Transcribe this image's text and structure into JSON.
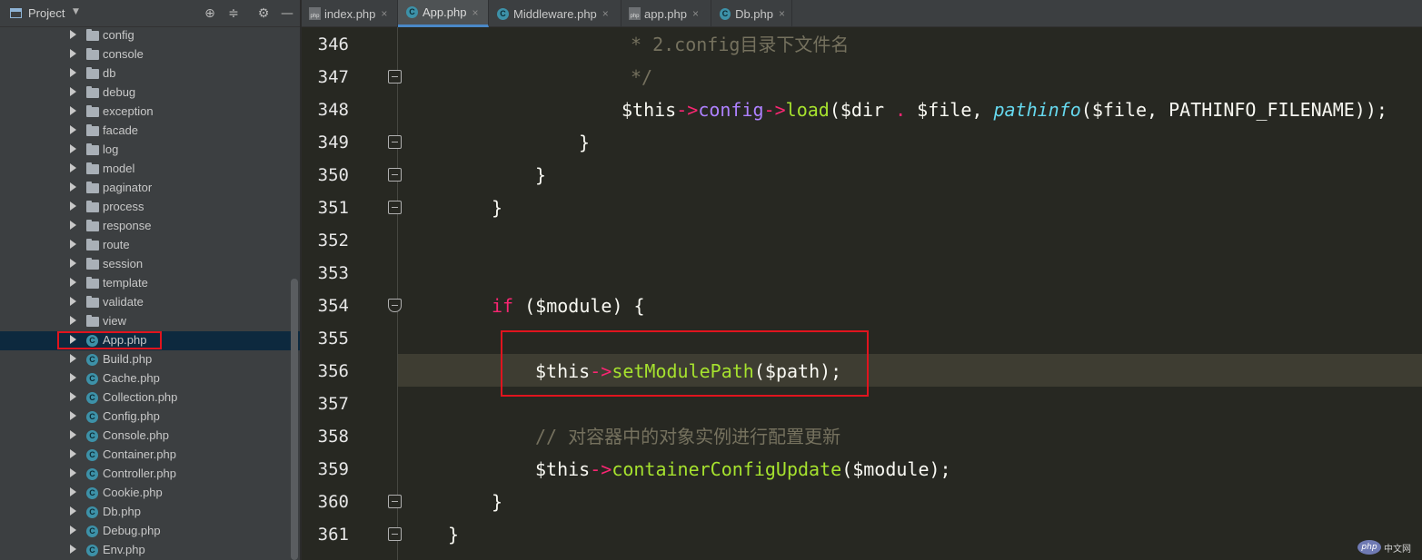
{
  "sidebar": {
    "title": "Project",
    "tree": [
      {
        "label": "config",
        "kind": "folder"
      },
      {
        "label": "console",
        "kind": "folder"
      },
      {
        "label": "db",
        "kind": "folder"
      },
      {
        "label": "debug",
        "kind": "folder"
      },
      {
        "label": "exception",
        "kind": "folder"
      },
      {
        "label": "facade",
        "kind": "folder"
      },
      {
        "label": "log",
        "kind": "folder"
      },
      {
        "label": "model",
        "kind": "folder"
      },
      {
        "label": "paginator",
        "kind": "folder"
      },
      {
        "label": "process",
        "kind": "folder"
      },
      {
        "label": "response",
        "kind": "folder"
      },
      {
        "label": "route",
        "kind": "folder"
      },
      {
        "label": "session",
        "kind": "folder"
      },
      {
        "label": "template",
        "kind": "folder"
      },
      {
        "label": "validate",
        "kind": "folder"
      },
      {
        "label": "view",
        "kind": "folder"
      },
      {
        "label": "App.php",
        "kind": "class",
        "selected": true
      },
      {
        "label": "Build.php",
        "kind": "class"
      },
      {
        "label": "Cache.php",
        "kind": "class"
      },
      {
        "label": "Collection.php",
        "kind": "class"
      },
      {
        "label": "Config.php",
        "kind": "class"
      },
      {
        "label": "Console.php",
        "kind": "class"
      },
      {
        "label": "Container.php",
        "kind": "class"
      },
      {
        "label": "Controller.php",
        "kind": "class"
      },
      {
        "label": "Cookie.php",
        "kind": "class"
      },
      {
        "label": "Db.php",
        "kind": "class"
      },
      {
        "label": "Debug.php",
        "kind": "class"
      },
      {
        "label": "Env.php",
        "kind": "class"
      }
    ]
  },
  "tabs": [
    {
      "label": "index.php",
      "icon": "php-file-icon",
      "active": false
    },
    {
      "label": "App.php",
      "icon": "class-icon",
      "active": true
    },
    {
      "label": "Middleware.php",
      "icon": "class-icon",
      "active": false
    },
    {
      "label": "app.php",
      "icon": "php-file-icon",
      "active": false
    },
    {
      "label": "Db.php",
      "icon": "class-icon",
      "active": false
    }
  ],
  "editor": {
    "lines": [
      {
        "number": "346",
        "fold": false,
        "indent": 362,
        "tokens": [
          [
            "c-comment",
            "* 2.config目录下文件名"
          ]
        ]
      },
      {
        "number": "347",
        "fold": true,
        "indent": 362,
        "tokens": [
          [
            "c-comment",
            "*/"
          ]
        ]
      },
      {
        "number": "348",
        "fold": false,
        "indent": 352,
        "tokens": [
          [
            "",
            "$this"
          ],
          [
            "c-op",
            "->"
          ],
          [
            "c-prop",
            "config"
          ],
          [
            "c-op",
            "->"
          ],
          [
            "c-method",
            "load"
          ],
          [
            "",
            "($dir "
          ],
          [
            "c-op",
            "."
          ],
          [
            "",
            " $file, "
          ],
          [
            "c-ital",
            "pathinfo"
          ],
          [
            "",
            "($file, PATHINFO_FILENAME));"
          ]
        ]
      },
      {
        "number": "349",
        "fold": true,
        "indent": 305,
        "tokens": [
          [
            "",
            "}"
          ]
        ]
      },
      {
        "number": "350",
        "fold": true,
        "indent": 257,
        "tokens": [
          [
            "",
            "}"
          ]
        ]
      },
      {
        "number": "351",
        "fold": true,
        "indent": 209,
        "tokens": [
          [
            "",
            "}"
          ]
        ]
      },
      {
        "number": "352",
        "fold": false,
        "indent": 209,
        "tokens": []
      },
      {
        "number": "353",
        "fold": false,
        "indent": 209,
        "tokens": []
      },
      {
        "number": "354",
        "fold": "open",
        "indent": 209,
        "tokens": [
          [
            "c-kw",
            "if"
          ],
          [
            "",
            " ($module) {"
          ]
        ]
      },
      {
        "number": "355",
        "fold": false,
        "indent": 257,
        "tokens": []
      },
      {
        "number": "356",
        "fold": false,
        "indent": 257,
        "tokens": [
          [
            "",
            "$this"
          ],
          [
            "c-op",
            "->"
          ],
          [
            "c-method",
            "setModulePath"
          ],
          [
            "",
            "($path);"
          ]
        ]
      },
      {
        "number": "357",
        "fold": false,
        "indent": 257,
        "tokens": []
      },
      {
        "number": "358",
        "fold": false,
        "indent": 257,
        "tokens": [
          [
            "c-comment",
            "// 对容器中的对象实例进行配置更新"
          ]
        ]
      },
      {
        "number": "359",
        "fold": false,
        "indent": 257,
        "tokens": [
          [
            "",
            "$this"
          ],
          [
            "c-op",
            "->"
          ],
          [
            "c-method",
            "containerConfigUpdate"
          ],
          [
            "",
            "($module);"
          ]
        ]
      },
      {
        "number": "360",
        "fold": true,
        "indent": 209,
        "tokens": [
          [
            "",
            "}"
          ]
        ]
      },
      {
        "number": "361",
        "fold": true,
        "indent": 161,
        "tokens": [
          [
            "",
            "}"
          ]
        ]
      }
    ]
  },
  "watermark": {
    "logo": "php",
    "text": "中文网"
  }
}
